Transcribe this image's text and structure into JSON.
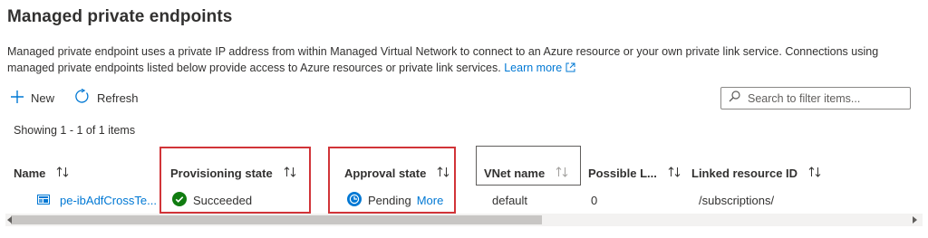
{
  "page": {
    "title": "Managed private endpoints",
    "description": "Managed private endpoint uses a private IP address from within Managed Virtual Network to connect to an Azure resource or your own private link service. Connections using managed private endpoints listed below provide access to Azure resources or private link services.",
    "learn_more": "Learn more"
  },
  "toolbar": {
    "new_label": "New",
    "refresh_label": "Refresh",
    "search_placeholder": "Search to filter items..."
  },
  "list": {
    "showing": "Showing 1 - 1 of 1 items",
    "columns": [
      "Name",
      "Provisioning state",
      "Approval state",
      "VNet name",
      "Possible L...",
      "Linked resource ID"
    ],
    "rows": [
      {
        "name": "pe-ibAdfCrossTe...",
        "provisioning_state": "Succeeded",
        "approval_state": "Pending",
        "approval_more": "More",
        "vnet_name": "default",
        "possible_l": "0",
        "linked_resource_id": "/subscriptions/"
      }
    ]
  },
  "colors": {
    "accent": "#0078d4",
    "success": "#107c10",
    "highlight_box": "#d13438"
  },
  "icons": [
    "plus-icon",
    "refresh-icon",
    "search-icon",
    "external-link-icon",
    "sort-icon",
    "endpoint-icon",
    "success-check-icon",
    "pending-icon"
  ]
}
